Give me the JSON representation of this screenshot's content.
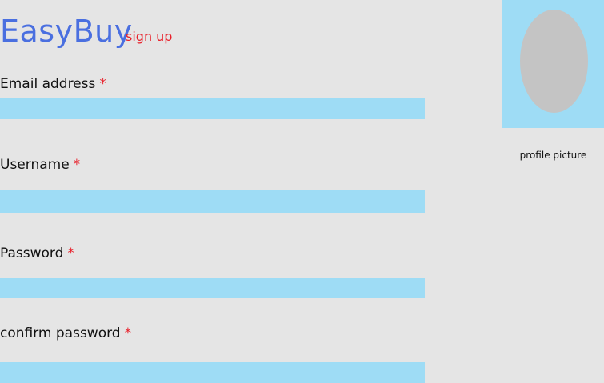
{
  "header": {
    "brand": "EasyBuy",
    "signup_link": "sign up"
  },
  "form": {
    "required_marker": "*",
    "email_label": "Email address",
    "email_value": "",
    "username_label": "Username",
    "username_value": "",
    "password_label": "Password",
    "password_value": "",
    "confirm_label": "confirm password",
    "confirm_value": ""
  },
  "profile": {
    "caption": "profile picture"
  },
  "colors": {
    "background": "#e5e5e5",
    "brand": "#4a6fe0",
    "accent_red": "#e8202a",
    "field_fill": "#9edcf5",
    "avatar_fill": "#c4c4c4"
  }
}
